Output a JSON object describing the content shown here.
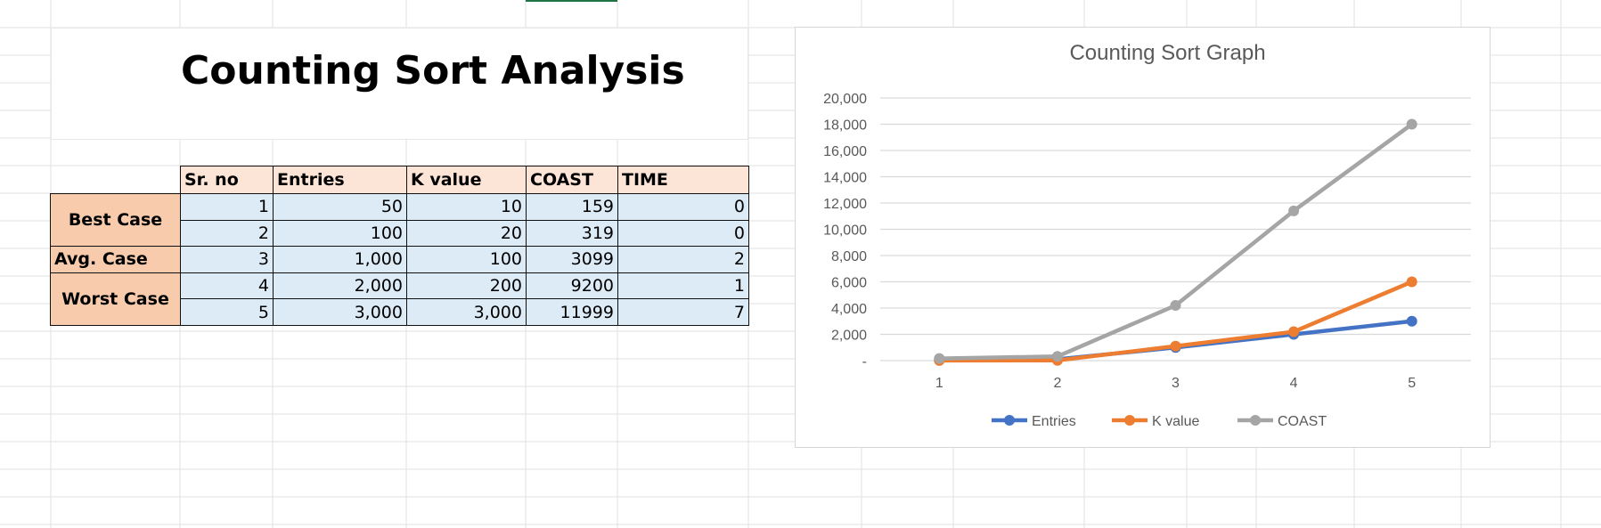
{
  "sheet": {
    "title": "Counting Sort Analysis",
    "table": {
      "headers": [
        "Sr. no",
        "Entries",
        "K value",
        "COAST",
        "TIME"
      ],
      "groups": [
        {
          "label": "Best Case",
          "rows": [
            [
              "1",
              "50",
              "10",
              "159",
              "0"
            ],
            [
              "2",
              "100",
              "20",
              "319",
              "0"
            ]
          ]
        },
        {
          "label": "Avg. Case",
          "rows": [
            [
              "3",
              "1,000",
              "100",
              "3099",
              "2"
            ]
          ]
        },
        {
          "label": "Worst Case",
          "rows": [
            [
              "4",
              "2,000",
              "200",
              "9200",
              "1"
            ],
            [
              "5",
              "3,000",
              "3,000",
              "11999",
              "7"
            ]
          ]
        }
      ]
    }
  },
  "chart_data": {
    "type": "line",
    "title": "Counting Sort Graph",
    "xlabel": "",
    "ylabel": "",
    "categories": [
      "1",
      "2",
      "3",
      "4",
      "5"
    ],
    "ylim": [
      0,
      20000
    ],
    "yticks": [
      "-",
      "2,000",
      "4,000",
      "6,000",
      "8,000",
      "10,000",
      "12,000",
      "14,000",
      "16,000",
      "18,000",
      "20,000"
    ],
    "grid": true,
    "legend": "bottom",
    "series": [
      {
        "name": "Entries",
        "color": "#4472c4",
        "values": [
          50,
          100,
          1000,
          2000,
          3000
        ]
      },
      {
        "name": "K value",
        "color": "#ed7d31",
        "values": [
          10,
          20,
          1100,
          2200,
          6000
        ]
      },
      {
        "name": "COAST",
        "color": "#a5a5a5",
        "values": [
          159,
          319,
          4200,
          11400,
          18000
        ]
      }
    ]
  }
}
